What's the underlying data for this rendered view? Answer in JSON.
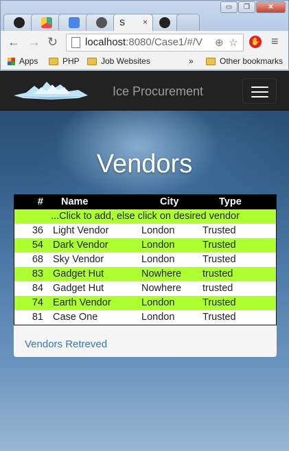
{
  "browser": {
    "window_buttons": {
      "minimize": "▭",
      "maximize": "❐",
      "close": "✕"
    },
    "active_tab_title": "S",
    "tab_close": "×",
    "url_host": "localhost",
    "url_rest": ":8080/Case1/#/V",
    "bookmarks": {
      "apps": "Apps",
      "php": "PHP",
      "job_websites": "Job Websites",
      "overflow": "»",
      "other": "Other bookmarks"
    }
  },
  "app": {
    "title": "Ice Procurement",
    "heading": "Vendors",
    "table": {
      "headers": {
        "num": "#",
        "name": "Name",
        "city": "City",
        "type": "Type"
      },
      "hint": "...Click to add, else click on desired vendor",
      "rows": [
        {
          "num": "36",
          "name": "Light Vendor",
          "city": "London",
          "type": "Trusted"
        },
        {
          "num": "54",
          "name": "Dark Vendor",
          "city": "London",
          "type": "Trusted"
        },
        {
          "num": "68",
          "name": "Sky Vendor",
          "city": "London",
          "type": "Trusted"
        },
        {
          "num": "83",
          "name": "Gadget Hut",
          "city": "Nowhere",
          "type": "trusted"
        },
        {
          "num": "84",
          "name": "Gadget Hut",
          "city": "Nowhere",
          "type": "trusted"
        },
        {
          "num": "74",
          "name": "Earth Vendor",
          "city": "London",
          "type": "Trusted"
        },
        {
          "num": "81",
          "name": "Case One",
          "city": "London",
          "type": "Trusted"
        }
      ]
    },
    "status": "Vendors Retreved"
  },
  "colors": {
    "row_highlight": "#adff2f",
    "navbar": "#222222",
    "link": "#337ab7"
  }
}
